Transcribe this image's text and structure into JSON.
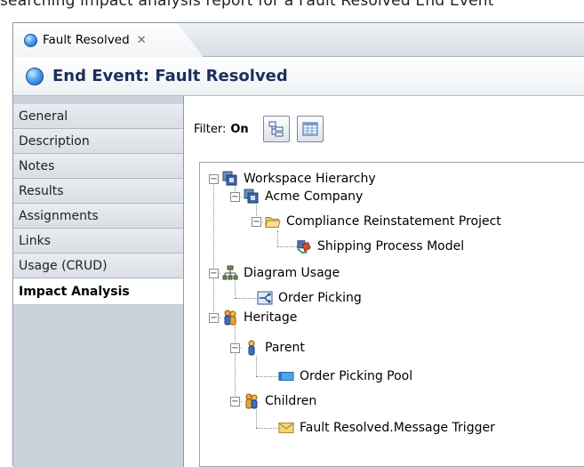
{
  "top_text": "searching impact analysis report for a Fault Resolved End Event",
  "tab": {
    "label": "Fault Resolved",
    "close_glyph": "✕",
    "icon": "blue-orb-icon"
  },
  "header": {
    "title": "End Event: Fault Resolved",
    "icon": "blue-orb-icon"
  },
  "sidebar": {
    "items": [
      {
        "label": "General",
        "active": false
      },
      {
        "label": "Description",
        "active": false
      },
      {
        "label": "Notes",
        "active": false
      },
      {
        "label": "Results",
        "active": false
      },
      {
        "label": "Assignments",
        "active": false
      },
      {
        "label": "Links",
        "active": false
      },
      {
        "label": "Usage (CRUD)",
        "active": false
      },
      {
        "label": "Impact Analysis",
        "active": true
      }
    ]
  },
  "filter": {
    "label": "Filter:",
    "value": "On",
    "buttons": [
      "tree-filter-icon",
      "table-view-icon"
    ]
  },
  "tree": {
    "workspace": {
      "label": "Workspace Hierarchy",
      "icon": "workspace-icon"
    },
    "company": {
      "label": "Acme Company",
      "icon": "workspace-icon"
    },
    "project": {
      "label": "Compliance Reinstatement Project",
      "icon": "folder-icon"
    },
    "model": {
      "label": "Shipping Process Model",
      "icon": "process-model-icon"
    },
    "diagram_usage": {
      "label": "Diagram Usage",
      "icon": "hierarchy-icon"
    },
    "order_picking": {
      "label": "Order Picking",
      "icon": "diagram-icon"
    },
    "heritage": {
      "label": "Heritage",
      "icon": "people-icon"
    },
    "parent": {
      "label": "Parent",
      "icon": "person-icon"
    },
    "pool": {
      "label": "Order Picking Pool",
      "icon": "pool-icon"
    },
    "children": {
      "label": "Children",
      "icon": "people-icon"
    },
    "trigger": {
      "label": "Fault Resolved.Message Trigger",
      "icon": "envelope-icon"
    }
  },
  "colors": {
    "title_text": "#1a2f5a",
    "sidebar_bg": "#cbd1da",
    "accent_blue": "#2f78d6"
  }
}
